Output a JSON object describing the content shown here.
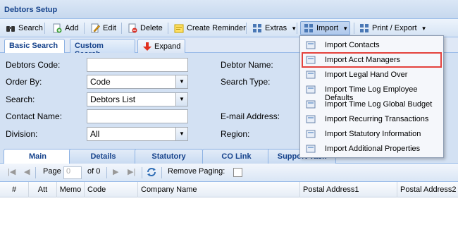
{
  "window": {
    "title": "Debtors Setup"
  },
  "toolbar": {
    "search": "Search",
    "add": "Add",
    "edit": "Edit",
    "delete": "Delete",
    "create_reminder": "Create Reminder",
    "extras": "Extras",
    "import": "Import",
    "print_export": "Print / Export"
  },
  "search_tabs": {
    "basic": "Basic Search",
    "custom": "Custom Search",
    "expand": "Expand"
  },
  "form": {
    "debtors_code_label": "Debtors Code:",
    "debtors_code_value": "",
    "order_by_label": "Order By:",
    "order_by_value": "Code",
    "search_label": "Search:",
    "search_value": "Debtors List",
    "contact_name_label": "Contact Name:",
    "contact_name_value": "",
    "division_label": "Division:",
    "division_value": "All",
    "debtor_name_label": "Debtor Name:",
    "search_type_label": "Search Type:",
    "email_label": "E-mail Address:",
    "region_label": "Region:"
  },
  "main_tabs": [
    "Main",
    "Details",
    "Statutory",
    "CO Link",
    "Support Task"
  ],
  "pager": {
    "page_label": "Page",
    "page_value": "0",
    "of_label": "of 0",
    "remove_paging": "Remove Paging:"
  },
  "grid": {
    "columns": [
      "#",
      "Att",
      "Memo",
      "Code",
      "Company Name",
      "Postal Address1",
      "Postal Address2"
    ]
  },
  "import_menu": {
    "items": [
      "Import Contacts",
      "Import Acct Managers",
      "Import Legal Hand Over",
      "Import Time Log Employee Defaults",
      "Import Time Log Global Budget",
      "Import Recurring Transactions",
      "Import Statutory Information",
      "Import Additional Properties"
    ],
    "highlighted": "Import Acct Managers",
    "highlight_color": "#e4423d"
  }
}
